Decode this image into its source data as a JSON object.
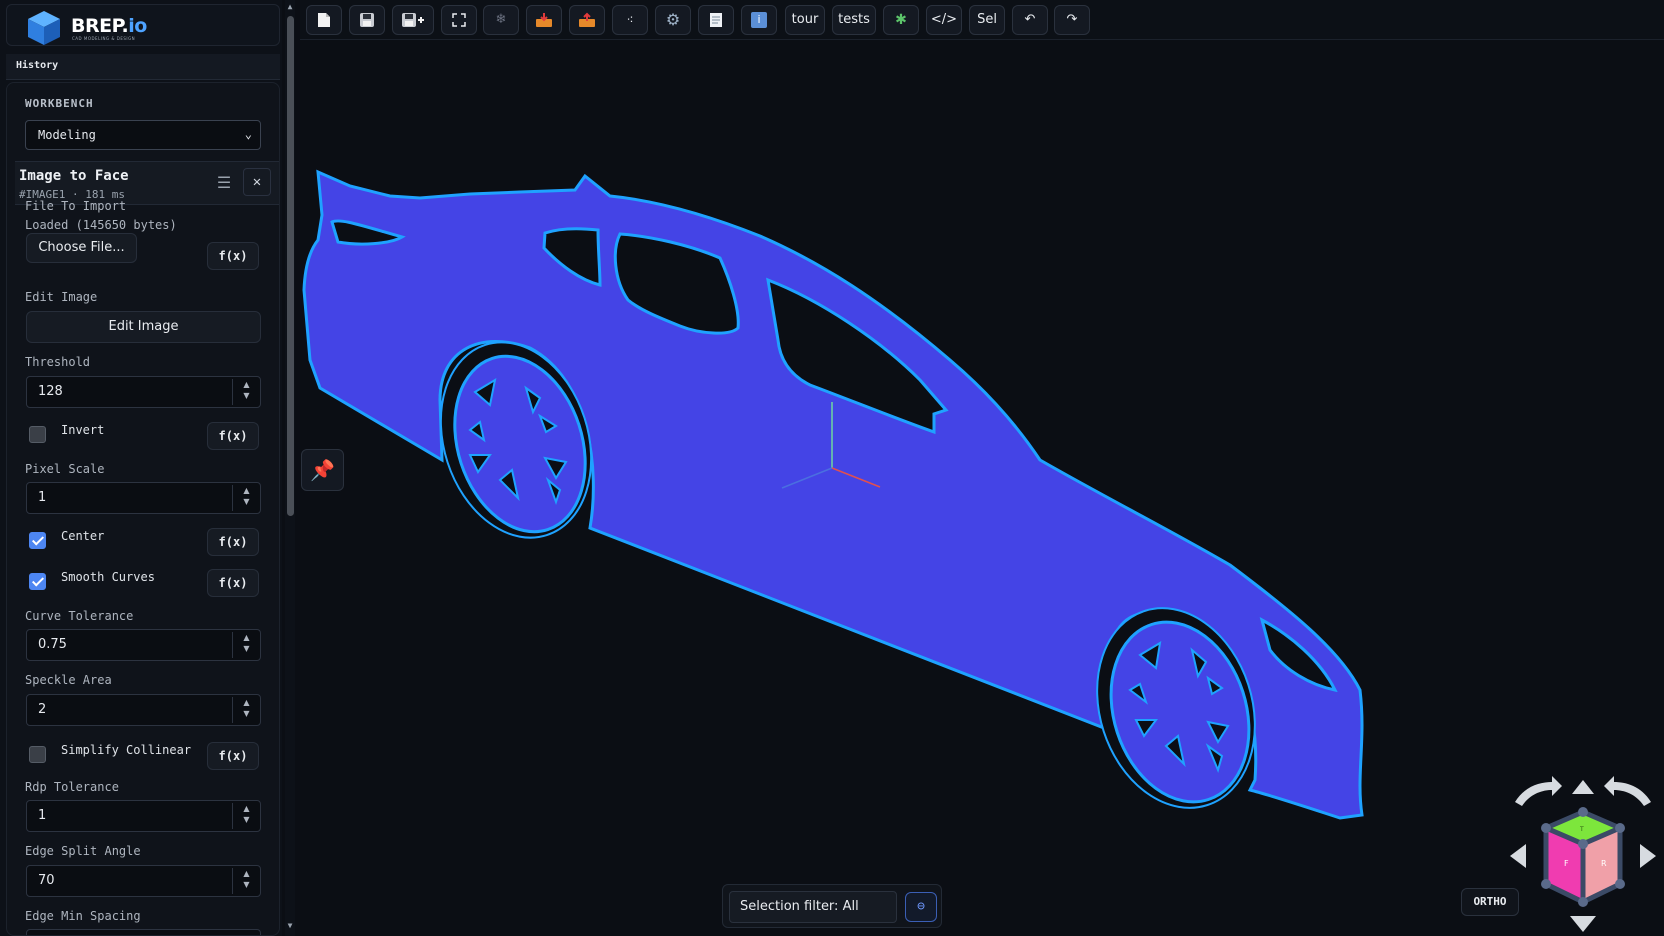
{
  "logo": {
    "name": "BREP.",
    "suffix": "io",
    "tagline": "CAD MODELING & DESIGN"
  },
  "history": {
    "title": "History"
  },
  "workbench": {
    "label": "WORKBENCH",
    "selected": "Modeling"
  },
  "feature": {
    "title": "Image to Face",
    "subtitle": "#IMAGE1 · 181 ms",
    "file": {
      "label": "File To Import",
      "status": "Loaded (145650 bytes)",
      "button": "Choose File..."
    },
    "edit": {
      "label": "Edit Image",
      "button": "Edit Image"
    },
    "threshold": {
      "label": "Threshold",
      "value": "128"
    },
    "invert": {
      "label": "Invert",
      "checked": false
    },
    "pixel_scale": {
      "label": "Pixel Scale",
      "value": "1"
    },
    "center": {
      "label": "Center",
      "checked": true
    },
    "smooth_curves": {
      "label": "Smooth Curves",
      "checked": true
    },
    "curve_tolerance": {
      "label": "Curve Tolerance",
      "value": "0.75"
    },
    "speckle_area": {
      "label": "Speckle Area",
      "value": "2"
    },
    "simplify_collinear": {
      "label": "Simplify Collinear",
      "checked": false
    },
    "rdp_tolerance": {
      "label": "Rdp Tolerance",
      "value": "1"
    },
    "edge_split_angle": {
      "label": "Edge Split Angle",
      "value": "70"
    },
    "edge_min_spacing": {
      "label": "Edge Min Spacing"
    },
    "fx_label": "f(x)"
  },
  "toolbar": {
    "icons": [
      "new-file-icon",
      "save-icon",
      "save-as-icon",
      "fit-view-icon",
      "snowflake-icon",
      "import-icon",
      "export-icon",
      "points-icon",
      "gear-icon",
      "notes-icon",
      "info-icon"
    ],
    "tour": "tour",
    "tests": "tests",
    "code": "</>",
    "sel": "Sel",
    "undo": "↶",
    "redo": "↷"
  },
  "viewport": {
    "selection_filter": "Selection filter: All",
    "ortho": "ORTHO",
    "navcube": {
      "front": "F",
      "right": "R",
      "top": "T"
    },
    "face_color": "#4444e6",
    "edge_color": "#1fa2ff"
  }
}
